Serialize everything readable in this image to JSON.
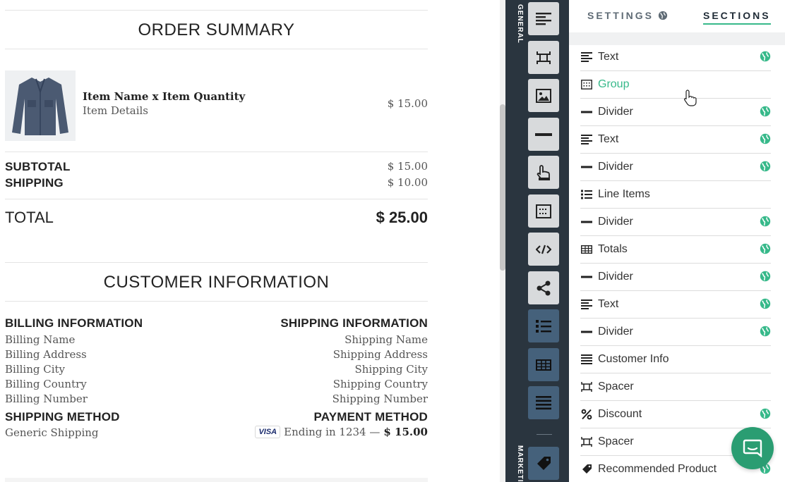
{
  "order_summary": {
    "title": "ORDER SUMMARY",
    "item": {
      "name": "Item Name x Item Quantity",
      "details": "Item Details",
      "price": "$ 15.00"
    },
    "subtotal_label": "SUBTOTAL",
    "subtotal_value": "$ 15.00",
    "shipping_label": "SHIPPING",
    "shipping_value": "$ 10.00",
    "total_label": "TOTAL",
    "total_value": "$ 25.00"
  },
  "customer_info": {
    "title": "CUSTOMER INFORMATION",
    "billing_heading": "BILLING INFORMATION",
    "billing_lines": [
      "Billing Name",
      "Billing Address",
      "Billing City",
      "Billing Country",
      "Billing Number"
    ],
    "shipping_heading": "SHIPPING INFORMATION",
    "shipping_lines": [
      "Shipping Name",
      "Shipping Address",
      "Shipping City",
      "Shipping Country",
      "Shipping Number"
    ],
    "shipping_method_heading": "SHIPPING METHOD",
    "shipping_method_value": "Generic Shipping",
    "payment_method_heading": "PAYMENT METHOD",
    "card_brand": "VISA",
    "payment_text": "Ending in 1234 —",
    "payment_amount": "$ 15.00"
  },
  "toolbar": {
    "general_label": "GENERAL",
    "marketing_label": "MARKETI"
  },
  "panel": {
    "tabs": {
      "settings": "SETTINGS",
      "sections": "SECTIONS"
    },
    "accent_color": "#37b98a",
    "rows": [
      {
        "icon": "text-icon",
        "label": "Text",
        "globe": true
      },
      {
        "icon": "group-icon",
        "label": "Group",
        "globe": false,
        "active": true
      },
      {
        "icon": "divider-icon",
        "label": "Divider",
        "globe": true
      },
      {
        "icon": "text-icon",
        "label": "Text",
        "globe": true
      },
      {
        "icon": "divider-icon",
        "label": "Divider",
        "globe": true
      },
      {
        "icon": "line-items-icon",
        "label": "Line Items",
        "globe": false
      },
      {
        "icon": "divider-icon",
        "label": "Divider",
        "globe": true
      },
      {
        "icon": "totals-icon",
        "label": "Totals",
        "globe": true
      },
      {
        "icon": "divider-icon",
        "label": "Divider",
        "globe": true
      },
      {
        "icon": "text-icon",
        "label": "Text",
        "globe": true
      },
      {
        "icon": "divider-icon",
        "label": "Divider",
        "globe": true
      },
      {
        "icon": "customer-info-icon",
        "label": "Customer Info",
        "globe": false
      },
      {
        "icon": "spacer-icon",
        "label": "Spacer",
        "globe": false
      },
      {
        "icon": "discount-icon",
        "label": "Discount",
        "globe": true
      },
      {
        "icon": "spacer-icon",
        "label": "Spacer",
        "globe": false
      },
      {
        "icon": "tag-icon",
        "label": "Recommended Product",
        "globe": true
      }
    ]
  }
}
